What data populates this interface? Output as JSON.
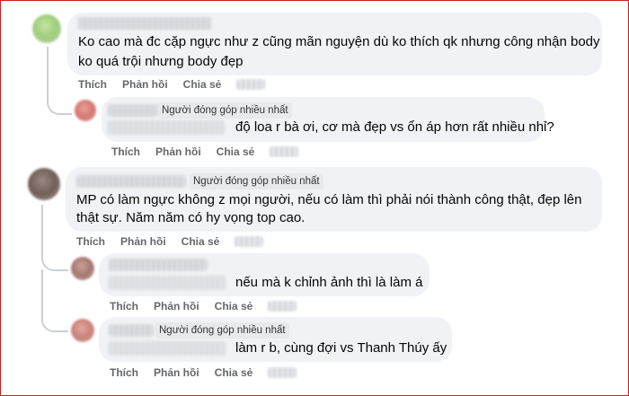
{
  "colors": {
    "frame": "#d21b1b",
    "bubble": "#f0f2f5",
    "action": "#65676b"
  },
  "actions": {
    "like": "Thích",
    "reply": "Phản hồi",
    "share": "Chia sẻ"
  },
  "comments": [
    {
      "badge": "",
      "lines": [
        "Ko cao mà đc cặp ngực như z cũng mãn nguyện dù ko thích qk nhưng công nhận body",
        "ko quá trội nhưng body đẹp"
      ]
    },
    {
      "badge": "Người đóng góp nhiều nhất",
      "lines": [
        "độ loa r bà ơi, cơ mà đẹp vs ổn áp hơn rất nhiều nhỉ?"
      ]
    },
    {
      "badge": "Người đóng góp nhiều nhất",
      "lines": [
        "MP có làm ngực không z mọi người, nếu có làm thì phải nói thành công thật, đẹp lên",
        "thật sự. Năm năm có hy vọng top cao."
      ]
    },
    {
      "badge": "",
      "lines": [
        "nếu mà k chỉnh ảnh thì là làm á"
      ]
    },
    {
      "badge": "Người đóng góp nhiều nhất",
      "lines": [
        "làm r b, cùng đợi vs Thanh Thúy ấy"
      ]
    }
  ]
}
